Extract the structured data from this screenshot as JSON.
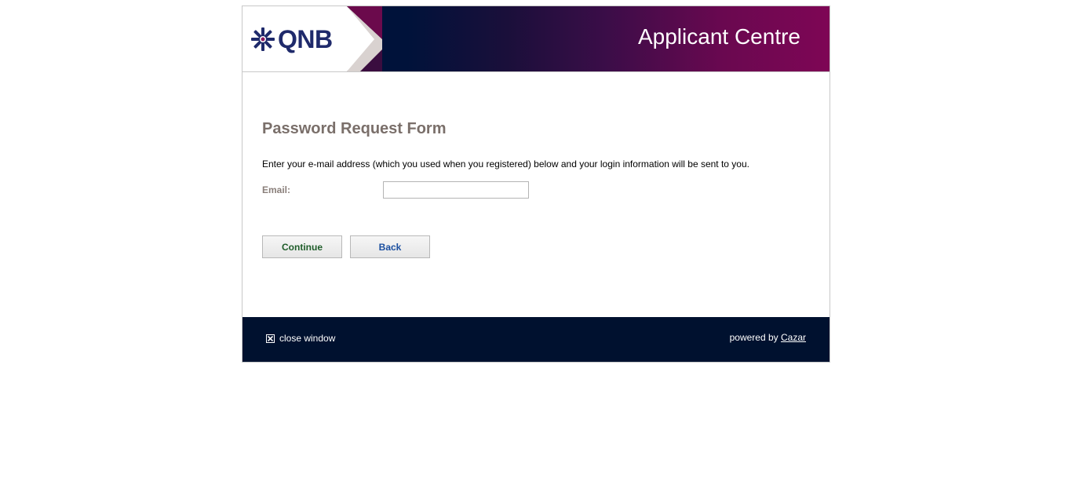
{
  "header": {
    "logo_text": "QNB",
    "title": "Applicant Centre"
  },
  "form": {
    "title": "Password Request Form",
    "instructions": "Enter your e-mail address (which you used when you registered) below and your login information will be sent to you.",
    "email_label": "Email:",
    "email_value": "",
    "email_placeholder": "",
    "continue_label": "Continue",
    "back_label": "Back"
  },
  "footer": {
    "close_label": "close window",
    "powered_prefix": "powered by",
    "powered_link": "Cazar"
  },
  "colors": {
    "header_dark": "#00123a",
    "header_accent": "#7e0655",
    "footer_bg": "#00112f",
    "title_color": "#7a6f6a",
    "continue_color": "#1f5d2a",
    "back_color": "#1b4fa0"
  },
  "icons": [
    "qnb-logo-icon",
    "close-icon"
  ]
}
